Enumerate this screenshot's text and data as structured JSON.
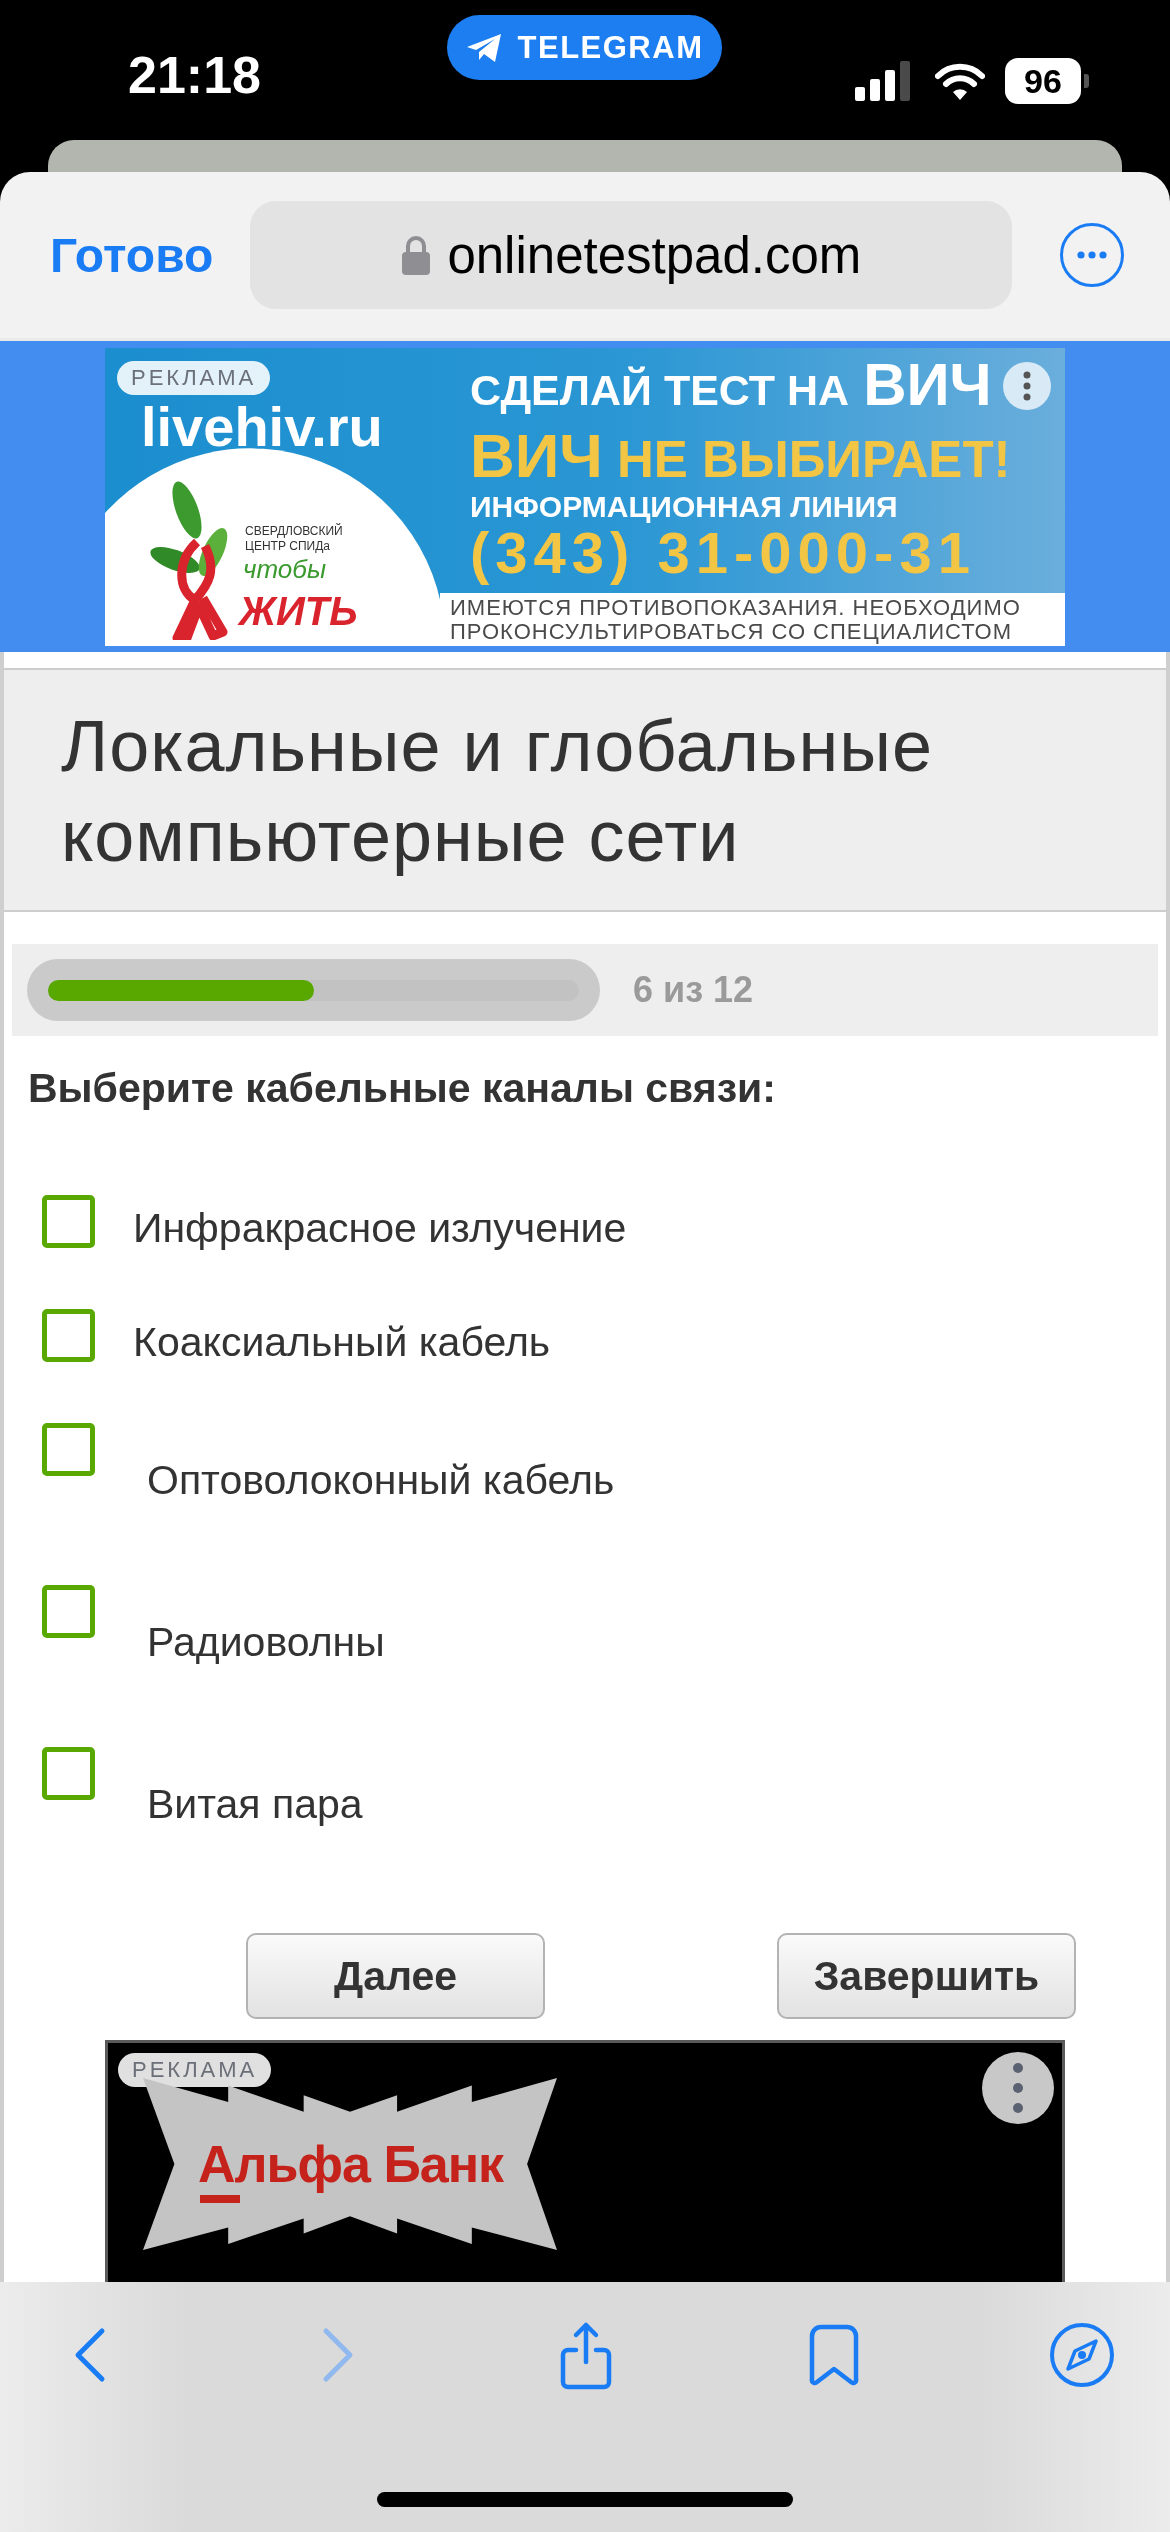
{
  "status_bar": {
    "time": "21:18",
    "return_app": "TELEGRAM",
    "battery": "96"
  },
  "browser_bar": {
    "done": "Готово",
    "url": "onlinetestpad.com"
  },
  "top_ad": {
    "badge": "РЕКЛАМА",
    "site": "livehiv.ru",
    "headline": "СДЕЛАЙ ТЕСТ НА",
    "headline_big": "ВИЧ",
    "slogan_big": "ВИЧ",
    "slogan": "НЕ ВЫБИРАЕТ!",
    "info_line": "ИНФОРМАЦИОННАЯ ЛИНИЯ",
    "phone": "(343) 31-000-31",
    "disclaimer": "ИМЕЮТСЯ ПРОТИВОПОКАЗАНИЯ. НЕОБХОДИМО ПРОКОНСУЛЬТИРОВАТЬСЯ СО СПЕЦИАЛИСТОМ",
    "logo_caption": "СВЕРДЛОВСКИЙ ЦЕНТР СПИДа",
    "logo_small": "чтобы",
    "logo_big": "ЖИТЬ"
  },
  "test": {
    "title": "Локальные и глобальные компьютерные сети",
    "progress": {
      "level": 0.5,
      "label": "6 из 12"
    },
    "question": "Выберите кабельные каналы связи:",
    "options": [
      {
        "kind": "inline",
        "label": "Инфракрасное излучение",
        "checked": false
      },
      {
        "kind": "inline",
        "label": "Коаксиальный кабель",
        "checked": false
      },
      {
        "kind": "block",
        "label": "Оптоволоконный кабель",
        "checked": false
      },
      {
        "kind": "block",
        "label": "Радиоволны",
        "checked": false
      },
      {
        "kind": "block",
        "label": "Витая пара",
        "checked": false
      }
    ],
    "buttons": [
      "Далее",
      "Завершить"
    ]
  },
  "bottom_ad": {
    "badge": "РЕКЛАМА",
    "brand": "Альфа Банк"
  },
  "toolbar": {
    "back": {
      "disabled": false
    },
    "forward": {
      "disabled": true
    }
  }
}
